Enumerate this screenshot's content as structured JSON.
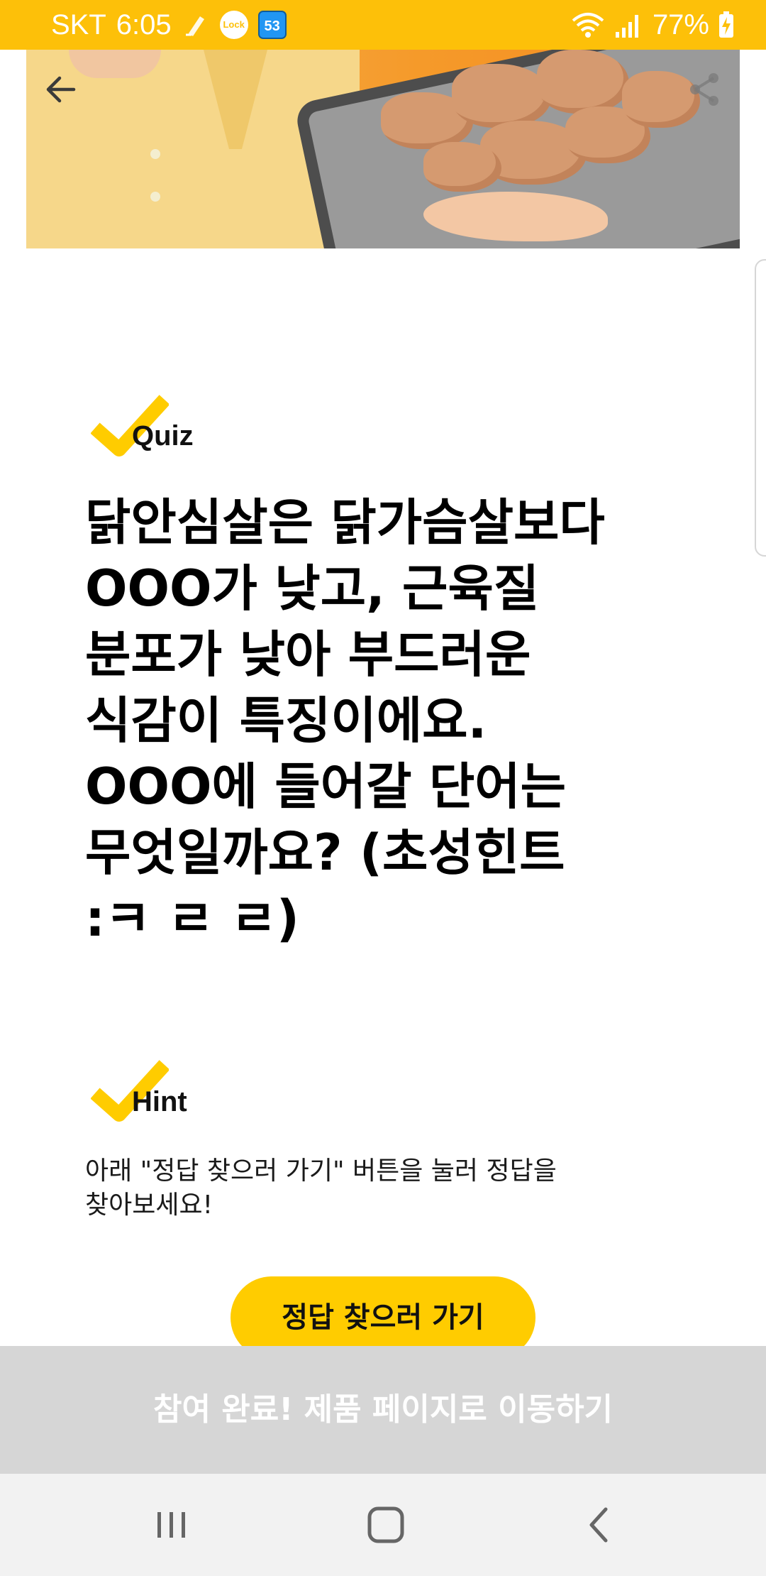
{
  "status_bar": {
    "carrier": "SKT",
    "time": "6:05",
    "notification_badge": "53",
    "olock_label": "Lock",
    "battery": "77%",
    "color": "#FDC009"
  },
  "quiz": {
    "label": "Quiz",
    "question": "닭안심살은 닭가슴살보다\nOOO가 낮고, 근육질\n분포가 낮아 부드러운\n식감이 특징이에요.\nOOO에 들어갈 단어는\n무엇일까요? (초성힌트\n:ㅋ ㄹ ㄹ)"
  },
  "hint": {
    "label": "Hint",
    "text": "아래 \"정답 찾으러 가기\" 버튼을 눌러 정답을\n찾아보세요!"
  },
  "answer_button": {
    "label": "정답 찾으러 가기",
    "color": "#FFCC00"
  },
  "bottom_cta": {
    "label": "참여 완료! 제품 페이지로 이동하기",
    "color": "#d6d6d6"
  },
  "icons": {
    "back": "back-arrow-icon",
    "share": "share-icon",
    "check": "checkmark-icon",
    "recent_apps": "recent-apps-icon",
    "home": "home-icon",
    "system_back": "system-back-icon"
  }
}
